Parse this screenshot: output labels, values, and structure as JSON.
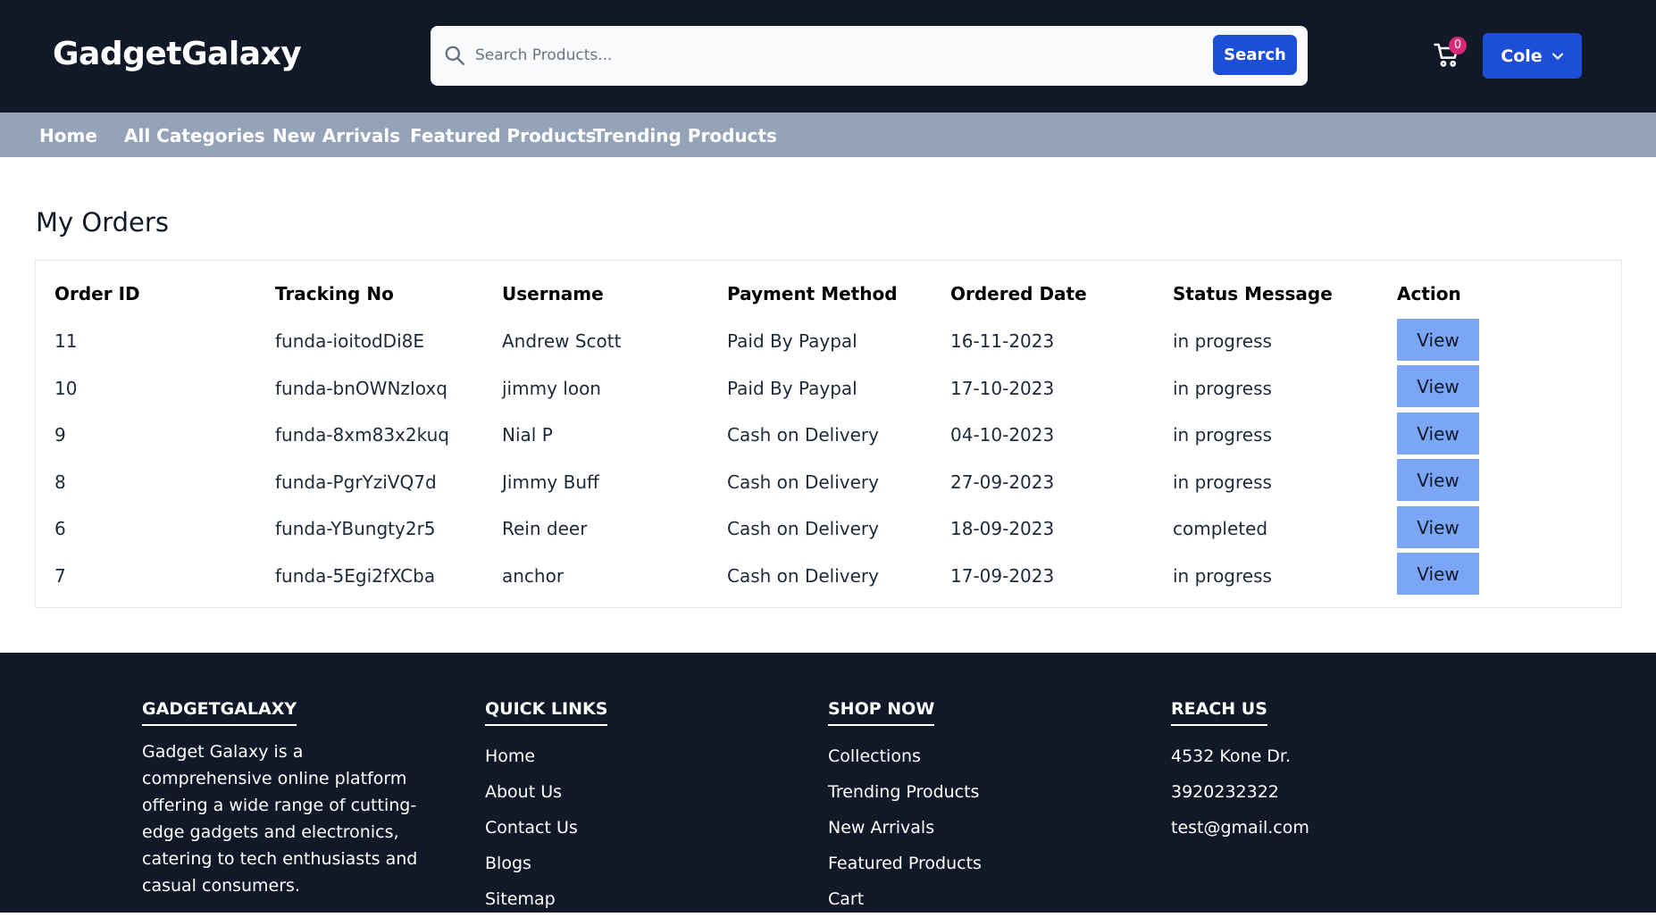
{
  "header": {
    "logo": "GadgetGalaxy",
    "search_placeholder": "Search Products...",
    "search_button": "Search",
    "cart_count": "0",
    "user_name": "Cole"
  },
  "nav": {
    "items": [
      "Home",
      "All Categories",
      "New Arrivals",
      "Featured Products",
      "Trending Products"
    ]
  },
  "orders": {
    "title": "My Orders",
    "columns": [
      "Order ID",
      "Tracking No",
      "Username",
      "Payment Method",
      "Ordered Date",
      "Status Message",
      "Action"
    ],
    "rows": [
      {
        "id": "11",
        "tracking": "funda-ioitodDi8E",
        "username": "Andrew Scott",
        "payment": "Paid By Paypal",
        "date": "16-11-2023",
        "status": "in progress",
        "action": "View"
      },
      {
        "id": "10",
        "tracking": "funda-bnOWNzIoxq",
        "username": "jimmy loon",
        "payment": "Paid By Paypal",
        "date": "17-10-2023",
        "status": "in progress",
        "action": "View"
      },
      {
        "id": "9",
        "tracking": "funda-8xm83x2kuq",
        "username": "Nial P",
        "payment": "Cash on Delivery",
        "date": "04-10-2023",
        "status": "in progress",
        "action": "View"
      },
      {
        "id": "8",
        "tracking": "funda-PgrYziVQ7d",
        "username": "Jimmy Buff",
        "payment": "Cash on Delivery",
        "date": "27-09-2023",
        "status": "in progress",
        "action": "View"
      },
      {
        "id": "6",
        "tracking": "funda-YBungty2r5",
        "username": "Rein deer",
        "payment": "Cash on Delivery",
        "date": "18-09-2023",
        "status": "completed",
        "action": "View"
      },
      {
        "id": "7",
        "tracking": "funda-5Egi2fXCba",
        "username": "anchor",
        "payment": "Cash on Delivery",
        "date": "17-09-2023",
        "status": "in progress",
        "action": "View"
      }
    ]
  },
  "footer": {
    "about": {
      "heading": "GADGETGALAXY",
      "text": "Gadget Galaxy is a comprehensive online platform offering a wide range of cutting-edge gadgets and electronics, catering to tech enthusiasts and casual consumers."
    },
    "quick_links": {
      "heading": "QUICK LINKS",
      "items": [
        "Home",
        "About Us",
        "Contact Us",
        "Blogs",
        "Sitemap"
      ]
    },
    "shop_now": {
      "heading": "SHOP NOW",
      "items": [
        "Collections",
        "Trending Products",
        "New Arrivals",
        "Featured Products",
        "Cart"
      ]
    },
    "reach_us": {
      "heading": "REACH US",
      "items": [
        "4532 Kone Dr.",
        "3920232322",
        "test@gmail.com"
      ]
    }
  },
  "colors": {
    "header_bg": "#111827",
    "nav_bg": "#94a3b8",
    "primary": "#1d4ed8",
    "view_button": "#7aa6f5",
    "badge": "#db2777"
  }
}
